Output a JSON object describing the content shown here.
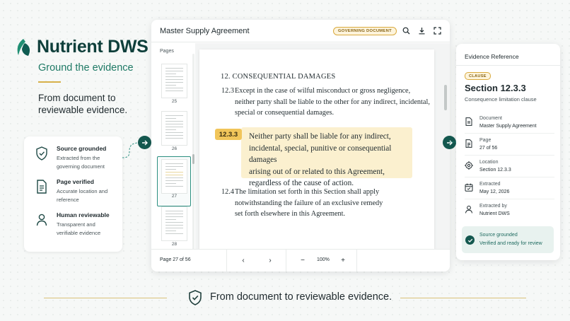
{
  "brand": {
    "name": "Nutrient DWS",
    "tagline": "Ground the evidence"
  },
  "left": {
    "heading": "From document to reviewable evidence.",
    "features": [
      {
        "title": "Source grounded",
        "desc": "Extracted from the governing document",
        "icon": "shield-check-icon"
      },
      {
        "title": "Page verified",
        "desc": "Accurate location and reference",
        "icon": "document-lines-icon"
      },
      {
        "title": "Human reviewable",
        "desc": "Transparent and verifiable evidence",
        "icon": "person-icon"
      }
    ]
  },
  "viewer": {
    "title": "Master Supply Agreement",
    "badge": "GOVERNING DOCUMENT",
    "pages_label": "Pages",
    "thumbnails": [
      "25",
      "26",
      "27",
      "28"
    ],
    "selected_page": "27",
    "section_heading": "12. CONSEQUENTIAL DAMAGES",
    "para_12_3": {
      "num": "12.3",
      "line1": "Except in the case of wilful misconduct or gross negligence,",
      "line2": "neither party shall be liable to the other for any indirect, incidental,",
      "line3": "special or consequential damages."
    },
    "highlight": {
      "label": "12.3.3",
      "line1": "Neither party shall be liable for any indirect,",
      "line2": "incidental, special, punitive or consequential damages",
      "line3": "arising out of or related to this Agreement,",
      "line4": "regardless of the cause of action."
    },
    "para_12_4": {
      "num": "12.4",
      "line1": "The limitation set forth in this Section shall apply",
      "line2": "notwithstanding the failure of an exclusive remedy",
      "line3": "set forth elsewhere in this Agreement."
    },
    "footer": {
      "page_indicator": "Page 27 of 56",
      "prev": "‹",
      "next": "›",
      "zoom_out": "−",
      "zoom_level": "100%",
      "zoom_in": "+"
    }
  },
  "evidence": {
    "title": "Evidence Reference",
    "badge": "CLAUSE",
    "section": "Section 12.3.3",
    "subtitle": "Consequence limitation clause",
    "items": [
      {
        "label": "Document",
        "value": "Master Supply Agreement",
        "icon": "document-icon"
      },
      {
        "label": "Page",
        "value": "27 of 56",
        "icon": "page-icon"
      },
      {
        "label": "Location",
        "value": "Section 12.3.3",
        "icon": "target-icon"
      },
      {
        "label": "Extracted",
        "value": "May 12, 2026",
        "icon": "calendar-icon"
      },
      {
        "label": "Extracted by",
        "value": "Nutrient DWS",
        "icon": "user-icon"
      }
    ],
    "status": {
      "line1": "Source grounded",
      "line2": "Verified and ready for review"
    }
  },
  "banner": {
    "text": "From document to reviewable evidence."
  },
  "colors": {
    "brand": "#0f3f3b",
    "accent": "#14584f",
    "highlight": "#fbf0cf",
    "gold": "#d9a93d"
  }
}
